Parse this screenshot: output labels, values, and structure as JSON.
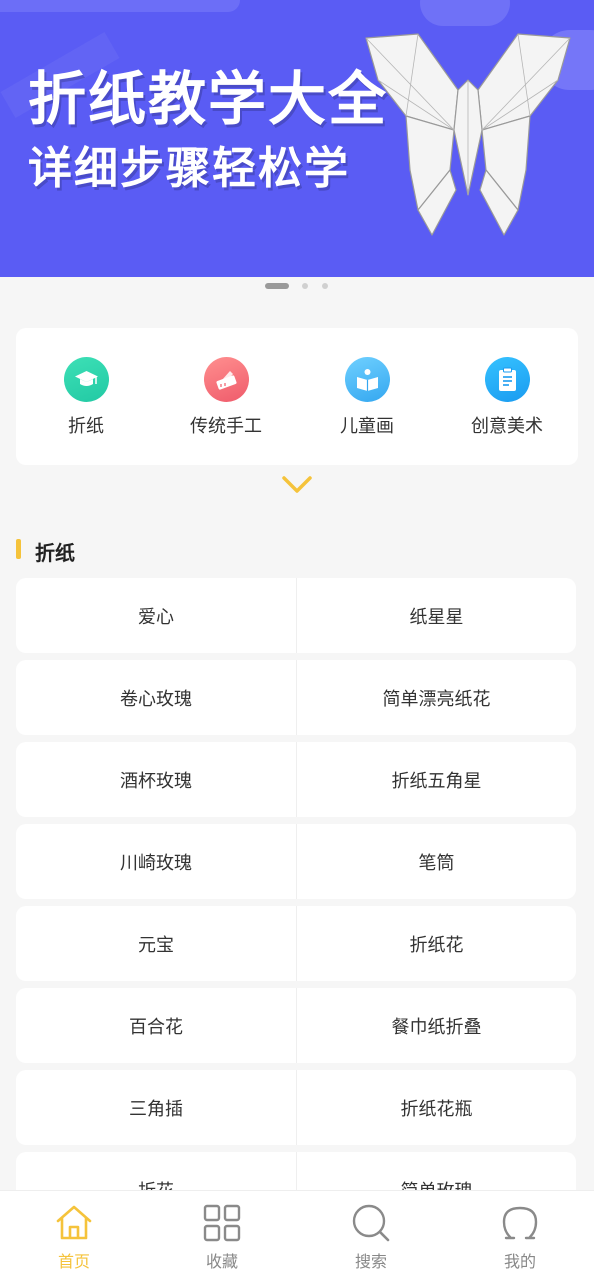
{
  "banner": {
    "title": "折纸教学大全",
    "subtitle": "详细步骤轻松学",
    "background": "#5a5cf4",
    "indicator": {
      "count": 3,
      "active": 0
    }
  },
  "categories": [
    {
      "label": "折纸",
      "icon": "graduation-cap-icon",
      "color_from": "#3de0b6",
      "color_to": "#22c9a4"
    },
    {
      "label": "传统手工",
      "icon": "pencil-ruler-icon",
      "color_from": "#ff8f8f",
      "color_to": "#ef5b6b"
    },
    {
      "label": "儿童画",
      "icon": "reading-book-icon",
      "color_from": "#6fd0ff",
      "color_to": "#34a7f0"
    },
    {
      "label": "创意美术",
      "icon": "clipboard-icon",
      "color_from": "#36c2ff",
      "color_to": "#1a9bf0"
    }
  ],
  "expand": {
    "icon": "chevron-down-icon",
    "color": "#f5c33b"
  },
  "section": {
    "title": "折纸",
    "accent": "#f5c33b"
  },
  "items": [
    [
      "爱心",
      "纸星星"
    ],
    [
      "卷心玫瑰",
      "简单漂亮纸花"
    ],
    [
      "酒杯玫瑰",
      "折纸五角星"
    ],
    [
      "川崎玫瑰",
      "笔筒"
    ],
    [
      "元宝",
      "折纸花"
    ],
    [
      "百合花",
      "餐巾纸折叠"
    ],
    [
      "三角插",
      "折纸花瓶"
    ],
    [
      "折花",
      "简单玫瑰"
    ]
  ],
  "tabbar": {
    "active_color": "#f5c33b",
    "inactive_color": "#888888",
    "tabs": [
      {
        "label": "首页",
        "icon": "home-icon",
        "active": true
      },
      {
        "label": "收藏",
        "icon": "grid-icon",
        "active": false
      },
      {
        "label": "搜索",
        "icon": "search-icon",
        "active": false
      },
      {
        "label": "我的",
        "icon": "user-icon",
        "active": false
      }
    ]
  }
}
